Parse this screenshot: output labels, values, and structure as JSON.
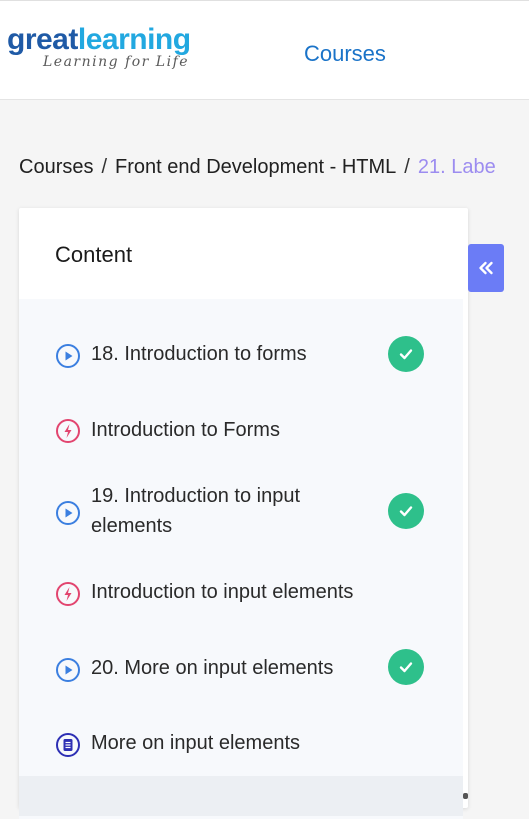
{
  "header": {
    "logo": {
      "part1": "great",
      "part2": "learning",
      "tagline": "Learning for Life"
    },
    "nav_courses": "Courses"
  },
  "breadcrumb": {
    "items": [
      "Courses",
      "Front end Development - HTML",
      "21. Labe"
    ],
    "separator": "/"
  },
  "panel": {
    "title": "Content",
    "items": [
      {
        "label": "18. Introduction to forms",
        "icon": "play-icon",
        "completed": true
      },
      {
        "label": "Introduction to Forms",
        "icon": "quiz-icon",
        "completed": false
      },
      {
        "label": "19. Introduction to input elements",
        "icon": "play-icon",
        "completed": true
      },
      {
        "label": "Introduction to input elements",
        "icon": "quiz-icon",
        "completed": false
      },
      {
        "label": "20. More on input elements",
        "icon": "play-icon",
        "completed": true
      },
      {
        "label": "More on input elements",
        "icon": "document-icon",
        "completed": false
      }
    ]
  },
  "collapse_button": {
    "icon": "double-chevron-left-icon",
    "glyph": "«"
  },
  "colors": {
    "accent": "#6b7cf6",
    "link": "#1a73c8",
    "success": "#2ec08b",
    "play_icon": "#3b7fe0",
    "quiz_icon": "#e2456f",
    "document_icon": "#2d2fb4",
    "breadcrumb_current": "#9c8cf0"
  }
}
